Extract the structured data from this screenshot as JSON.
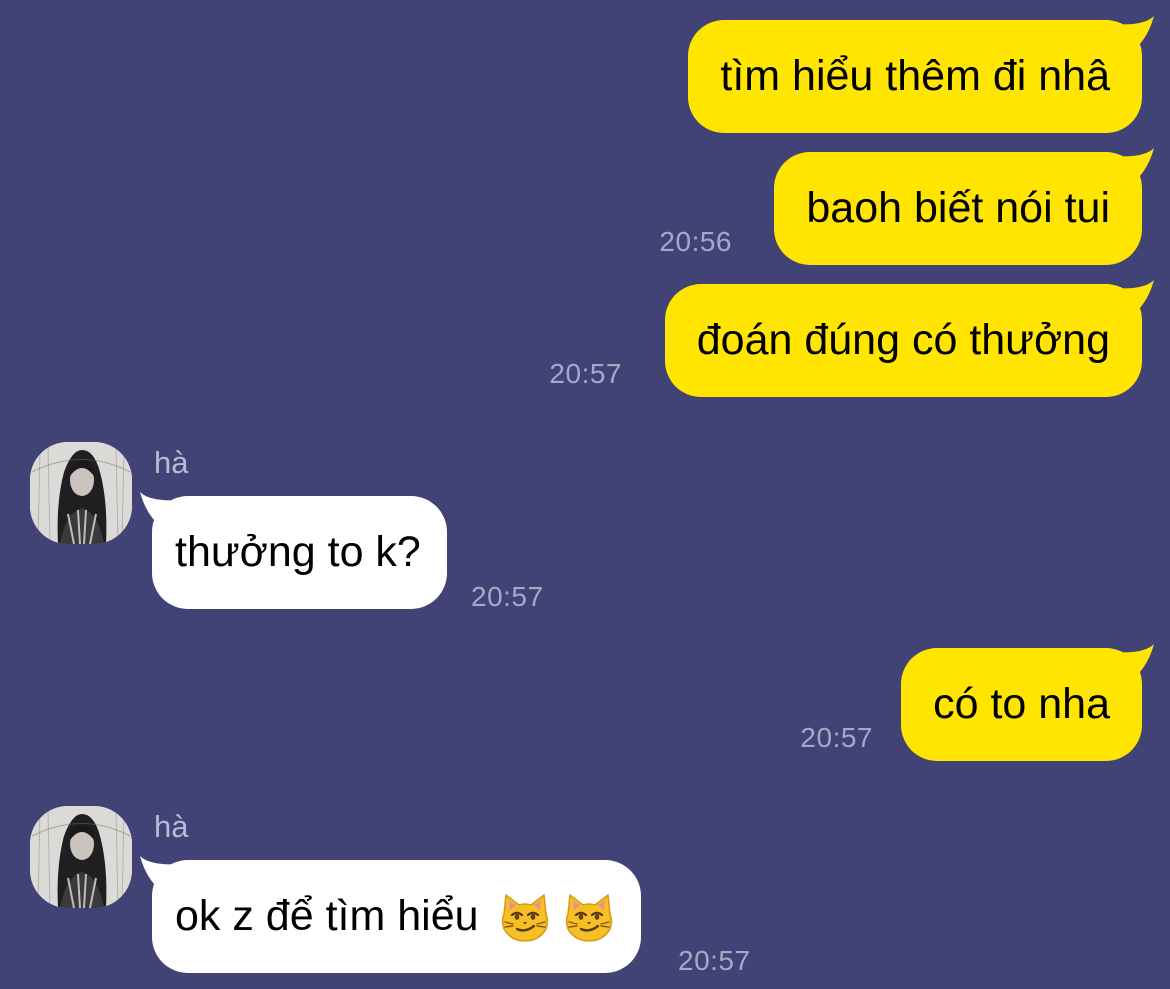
{
  "colors": {
    "background": "#414276",
    "outgoing_bubble": "#ffe500",
    "incoming_bubble": "#ffffff",
    "timestamp": "#a7a8c8"
  },
  "messages": [
    {
      "direction": "outgoing",
      "text": "tìm hiểu thêm đi nhâ",
      "time": ""
    },
    {
      "direction": "outgoing",
      "text": "baoh biết nói tui",
      "time": "20:56"
    },
    {
      "direction": "outgoing",
      "text": "đoán đúng có thưởng",
      "time": "20:57"
    },
    {
      "direction": "incoming",
      "sender": "hà",
      "text": "thưởng to k?",
      "time": "20:57"
    },
    {
      "direction": "outgoing",
      "text": "có to nha",
      "time": "20:57"
    },
    {
      "direction": "incoming",
      "sender": "hà",
      "text": "ok z để tìm hiểu",
      "emoji": [
        "smirking-cat-icon",
        "smirking-cat-icon"
      ],
      "time": "20:57"
    }
  ]
}
